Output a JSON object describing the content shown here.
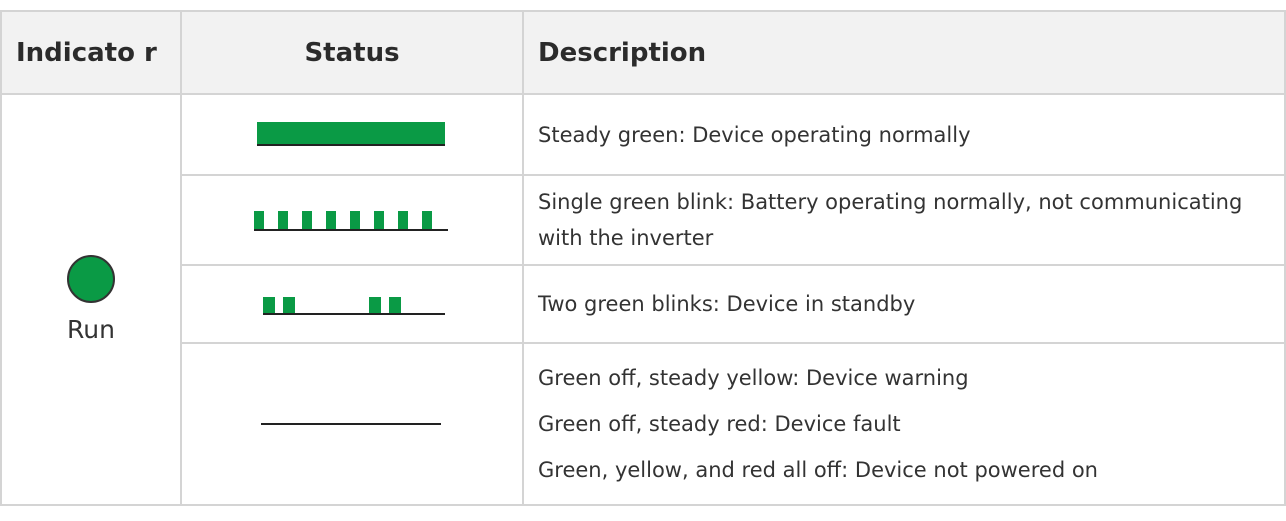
{
  "header": {
    "indicator": "Indicato r",
    "status": "Status",
    "description": "Description"
  },
  "indicator": {
    "name": "Run",
    "led_color": "#0a9a45",
    "icon": "green-led-icon"
  },
  "rows": [
    {
      "status_pattern": "steady",
      "description": "Steady green: Device operating normally"
    },
    {
      "status_pattern": "single-blink",
      "description": "Single green blink: Battery operating normally, not communicating with the inverter"
    },
    {
      "status_pattern": "two-blinks",
      "description": "Two green blinks: Device in standby"
    },
    {
      "status_pattern": "off",
      "descriptions": [
        "Green off, steady yellow: Device warning",
        "Green off, steady red: Device fault",
        "Green, yellow, and red all off: Device not powered on"
      ]
    }
  ],
  "colors": {
    "green": "#0a9a45",
    "line": "#222222",
    "header_bg": "#f2f2f2",
    "border": "#d4d4d4"
  }
}
